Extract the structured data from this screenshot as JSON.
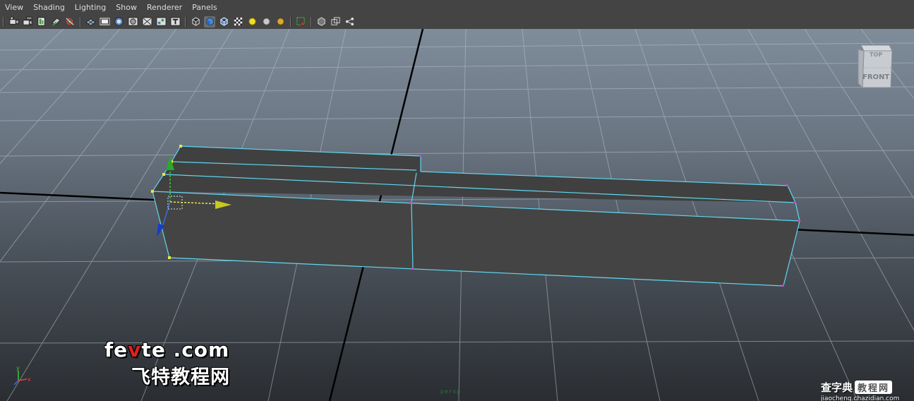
{
  "menu": {
    "items": [
      "View",
      "Shading",
      "Lighting",
      "Show",
      "Renderer",
      "Panels"
    ]
  },
  "toolbar": {
    "groups": [
      [
        "camera-icon",
        "camera-attributes-icon",
        "bookmark-icon",
        "image-plane-icon",
        "two-d-pan-zoom-icon"
      ],
      [
        "grid-icon",
        "film-gate-icon",
        "resolution-gate-icon",
        "gate-mask-icon",
        "field-chart-icon",
        "safe-action-icon",
        "safe-title-icon"
      ],
      [
        "wireframe-icon",
        "smooth-shade-icon",
        "wireframe-on-shaded-icon",
        "textured-icon",
        "use-all-lights-icon",
        "shadows-icon",
        "occlusion-icon"
      ],
      [
        "select-camera-icon"
      ],
      [
        "isolate-select-icon",
        "xray-icon",
        "component-xray-icon"
      ]
    ],
    "active": "smooth-shade-icon"
  },
  "viewport": {
    "viewcube": {
      "top": "TOP",
      "front": "FRONT"
    },
    "camera_label": "persp",
    "axis": {
      "y": "y",
      "x": "x"
    }
  },
  "watermark": {
    "brand_pre": "fe",
    "brand_v": "v",
    "brand_post": "te .com",
    "cn": "飞特教程网",
    "site_a": "查字典",
    "site_b": "教程网",
    "url": "jiaocheng.chazidian.com"
  },
  "colors": {
    "ui_bg": "#444444",
    "selection": "#5fd8f0",
    "vertex_selected": "#e8e840",
    "vertex": "#d040d0",
    "mesh_face": "#444444"
  }
}
